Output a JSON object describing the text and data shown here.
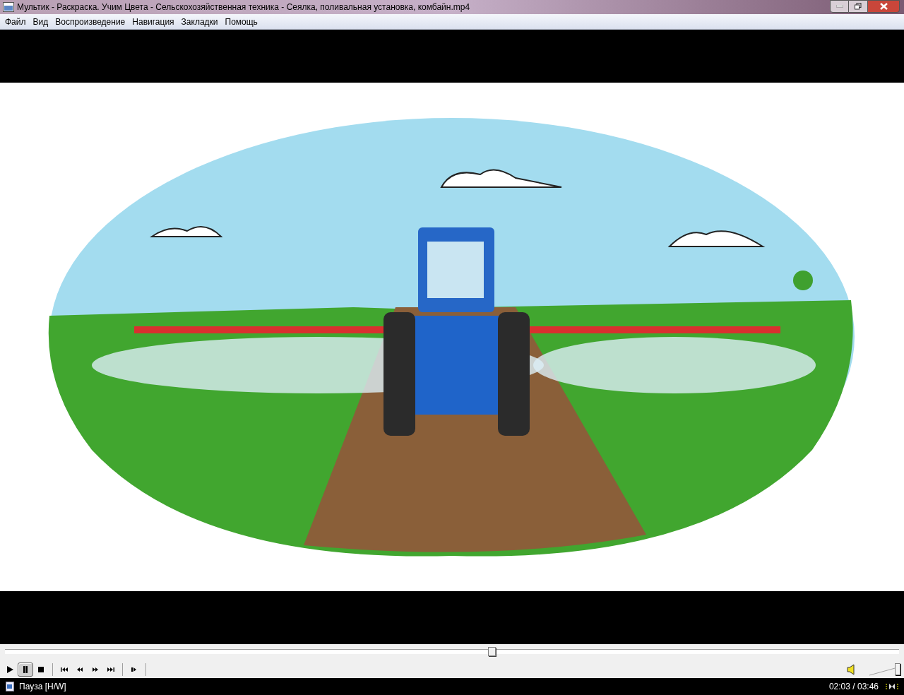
{
  "window": {
    "title": "Мультик - Раскраска. Учим Цвета - Сельскохозяйственная техника - Сеялка, поливальная установка, комбайн.mp4"
  },
  "menu": [
    "Файл",
    "Вид",
    "Воспроизведение",
    "Навигация",
    "Закладки",
    "Помощь"
  ],
  "seek": {
    "level": 0.544
  },
  "controls": [
    {
      "kind": "play",
      "selected": false
    },
    {
      "kind": "pause",
      "selected": true
    },
    {
      "kind": "stop",
      "selected": false
    },
    {
      "kind": "sep"
    },
    {
      "kind": "prev",
      "selected": false
    },
    {
      "kind": "rewind",
      "selected": false
    },
    {
      "kind": "forward",
      "selected": false
    },
    {
      "kind": "next",
      "selected": false
    },
    {
      "kind": "sep"
    },
    {
      "kind": "step",
      "selected": false
    },
    {
      "kind": "sep"
    }
  ],
  "volume": {
    "level": 1
  },
  "status": {
    "state": "Пауза [H/W]",
    "time": "02:03 / 03:46"
  }
}
